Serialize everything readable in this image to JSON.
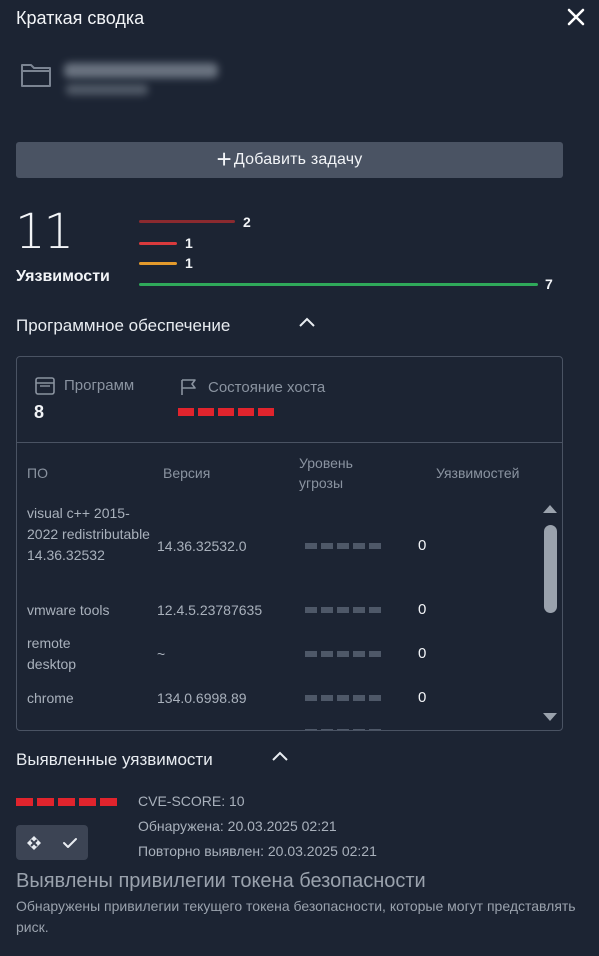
{
  "header": {
    "title": "Краткая сводка"
  },
  "add_task": {
    "label": "Добавить задачу"
  },
  "vulnerabilities_summary": {
    "total": "11",
    "label": "Уязвимости",
    "severity": [
      {
        "level": "critical",
        "count": "2",
        "color": "#8b2a2f"
      },
      {
        "level": "high",
        "count": "1",
        "color": "#d93a3d"
      },
      {
        "level": "medium",
        "count": "1",
        "color": "#e39a2c"
      },
      {
        "level": "low",
        "count": "7",
        "color": "#2fa95a"
      }
    ]
  },
  "software": {
    "title": "Программное обеспечение",
    "programs_label": "Программ",
    "programs_count": "8",
    "host_state_label": "Состояние хоста",
    "host_state_color": "#e0242d",
    "columns": {
      "name": "ПО",
      "version": "Версия",
      "threat": "Уровень угрозы",
      "vulns": "Уязвимостей"
    },
    "rows": [
      {
        "name": "visual c++ 2015-2022 redistributable 14.36.32532",
        "version": "14.36.32532.0",
        "vulns": "0"
      },
      {
        "name": "vmware tools",
        "version": "12.4.5.23787635",
        "vulns": "0"
      },
      {
        "name": "remote desktop",
        "version": "~",
        "vulns": "0"
      },
      {
        "name": "chrome",
        "version": "134.0.6998.89",
        "vulns": "0"
      }
    ]
  },
  "found": {
    "title": "Выявленные уязвимости",
    "severity_color": "#e0242d",
    "cve_score": "CVE-SCORE: 10",
    "detected": "Обнаружена: 20.03.2025 02:21",
    "redetected": "Повторно выявлен: 20.03.2025 02:21",
    "vuln_title": "Выявлены привилегии токена безопасности",
    "vuln_desc": "Обнаружены привилегии текущего токена безопасности, которые могут представлять риск."
  }
}
